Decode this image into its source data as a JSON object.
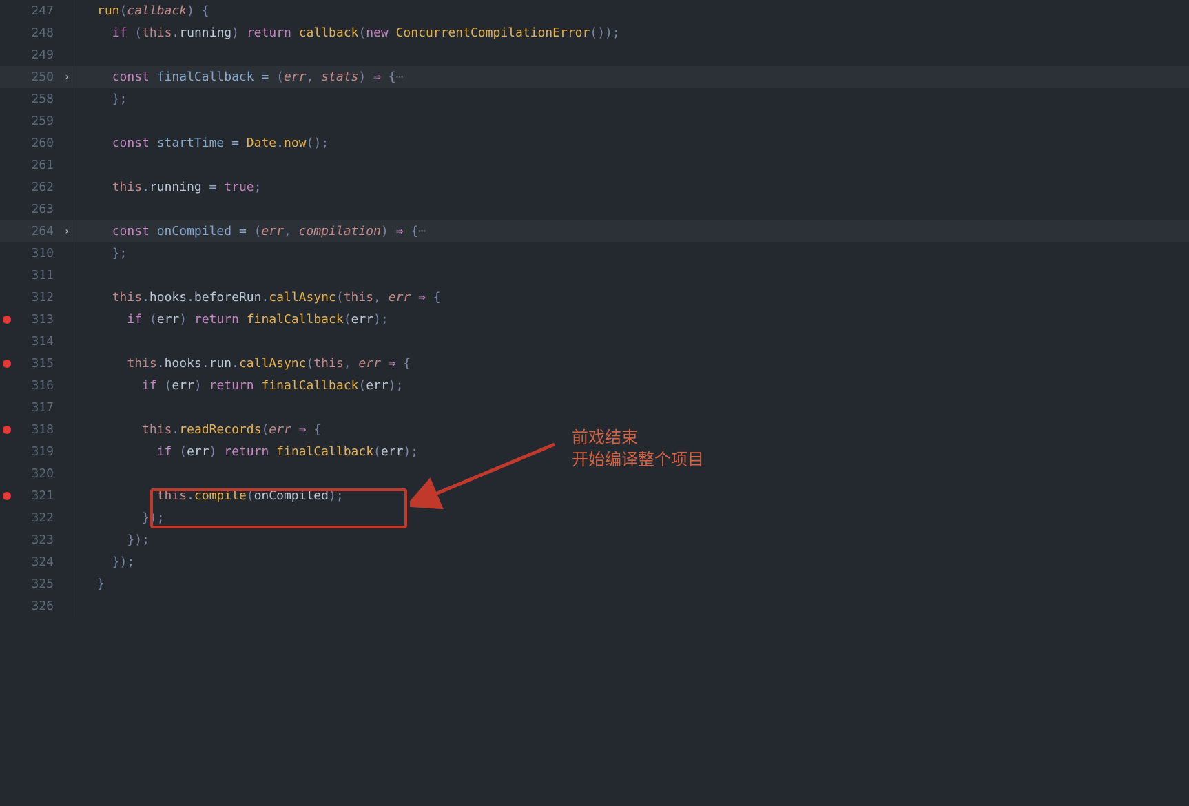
{
  "editor": {
    "font": "monospace",
    "background": "#24292f",
    "accent_breakpoint": "#e53935",
    "annotation_color": "#d36343"
  },
  "annotation": {
    "line1": "前戏结束",
    "line2": "开始编译整个项目"
  },
  "lines": [
    {
      "no": "247",
      "bp": false,
      "fold": "",
      "hl": false,
      "tokens": [
        {
          "t": "fn",
          "v": "run"
        },
        {
          "t": "br",
          "v": "("
        },
        {
          "t": "arg",
          "v": "callback"
        },
        {
          "t": "br",
          "v": ") {"
        }
      ]
    },
    {
      "no": "248",
      "bp": false,
      "fold": "",
      "hl": false,
      "tokens": [
        {
          "t": "id",
          "v": "  "
        },
        {
          "t": "kw",
          "v": "if"
        },
        {
          "t": "br",
          "v": " ("
        },
        {
          "t": "this",
          "v": "this"
        },
        {
          "t": "op",
          "v": "."
        },
        {
          "t": "id",
          "v": "running"
        },
        {
          "t": "br",
          "v": ") "
        },
        {
          "t": "kw",
          "v": "return"
        },
        {
          "t": "id",
          "v": " "
        },
        {
          "t": "fn",
          "v": "callback"
        },
        {
          "t": "br",
          "v": "("
        },
        {
          "t": "kw",
          "v": "new"
        },
        {
          "t": "id",
          "v": " "
        },
        {
          "t": "type",
          "v": "ConcurrentCompilationError"
        },
        {
          "t": "br",
          "v": "());"
        }
      ]
    },
    {
      "no": "249",
      "bp": false,
      "fold": "",
      "hl": false,
      "tokens": []
    },
    {
      "no": "250",
      "bp": false,
      "fold": "›",
      "hl": true,
      "tokens": [
        {
          "t": "id",
          "v": "  "
        },
        {
          "t": "kw",
          "v": "const"
        },
        {
          "t": "id",
          "v": " "
        },
        {
          "t": "fnid",
          "v": "finalCallback"
        },
        {
          "t": "id",
          "v": " "
        },
        {
          "t": "op",
          "v": "="
        },
        {
          "t": "id",
          "v": " "
        },
        {
          "t": "br",
          "v": "("
        },
        {
          "t": "arg",
          "v": "err"
        },
        {
          "t": "br",
          "v": ", "
        },
        {
          "t": "arg",
          "v": "stats"
        },
        {
          "t": "br",
          "v": ") "
        },
        {
          "t": "arrow",
          "v": "⇒"
        },
        {
          "t": "br",
          "v": " {"
        },
        {
          "t": "fold-ellipsis",
          "v": "⋯"
        }
      ]
    },
    {
      "no": "258",
      "bp": false,
      "fold": "",
      "hl": false,
      "tokens": [
        {
          "t": "id",
          "v": "  "
        },
        {
          "t": "br",
          "v": "};"
        }
      ]
    },
    {
      "no": "259",
      "bp": false,
      "fold": "",
      "hl": false,
      "tokens": []
    },
    {
      "no": "260",
      "bp": false,
      "fold": "",
      "hl": false,
      "tokens": [
        {
          "t": "id",
          "v": "  "
        },
        {
          "t": "kw",
          "v": "const"
        },
        {
          "t": "id",
          "v": " "
        },
        {
          "t": "fnid",
          "v": "startTime"
        },
        {
          "t": "id",
          "v": " "
        },
        {
          "t": "op",
          "v": "="
        },
        {
          "t": "id",
          "v": " "
        },
        {
          "t": "type",
          "v": "Date"
        },
        {
          "t": "op",
          "v": "."
        },
        {
          "t": "fn",
          "v": "now"
        },
        {
          "t": "br",
          "v": "();"
        }
      ]
    },
    {
      "no": "261",
      "bp": false,
      "fold": "",
      "hl": false,
      "tokens": []
    },
    {
      "no": "262",
      "bp": false,
      "fold": "",
      "hl": false,
      "tokens": [
        {
          "t": "id",
          "v": "  "
        },
        {
          "t": "this",
          "v": "this"
        },
        {
          "t": "op",
          "v": "."
        },
        {
          "t": "id",
          "v": "running"
        },
        {
          "t": "id",
          "v": " "
        },
        {
          "t": "op",
          "v": "="
        },
        {
          "t": "id",
          "v": " "
        },
        {
          "t": "kw",
          "v": "true"
        },
        {
          "t": "br",
          "v": ";"
        }
      ]
    },
    {
      "no": "263",
      "bp": false,
      "fold": "",
      "hl": false,
      "tokens": []
    },
    {
      "no": "264",
      "bp": false,
      "fold": "›",
      "hl": true,
      "tokens": [
        {
          "t": "id",
          "v": "  "
        },
        {
          "t": "kw",
          "v": "const"
        },
        {
          "t": "id",
          "v": " "
        },
        {
          "t": "fnid",
          "v": "onCompiled"
        },
        {
          "t": "id",
          "v": " "
        },
        {
          "t": "op",
          "v": "="
        },
        {
          "t": "id",
          "v": " "
        },
        {
          "t": "br",
          "v": "("
        },
        {
          "t": "arg",
          "v": "err"
        },
        {
          "t": "br",
          "v": ", "
        },
        {
          "t": "arg",
          "v": "compilation"
        },
        {
          "t": "br",
          "v": ") "
        },
        {
          "t": "arrow",
          "v": "⇒"
        },
        {
          "t": "br",
          "v": " {"
        },
        {
          "t": "fold-ellipsis",
          "v": "⋯"
        }
      ]
    },
    {
      "no": "310",
      "bp": false,
      "fold": "",
      "hl": false,
      "tokens": [
        {
          "t": "id",
          "v": "  "
        },
        {
          "t": "br",
          "v": "};"
        }
      ]
    },
    {
      "no": "311",
      "bp": false,
      "fold": "",
      "hl": false,
      "tokens": []
    },
    {
      "no": "312",
      "bp": false,
      "fold": "",
      "hl": false,
      "tokens": [
        {
          "t": "id",
          "v": "  "
        },
        {
          "t": "this",
          "v": "this"
        },
        {
          "t": "op",
          "v": "."
        },
        {
          "t": "id",
          "v": "hooks"
        },
        {
          "t": "op",
          "v": "."
        },
        {
          "t": "id",
          "v": "beforeRun"
        },
        {
          "t": "op",
          "v": "."
        },
        {
          "t": "fn",
          "v": "callAsync"
        },
        {
          "t": "br",
          "v": "("
        },
        {
          "t": "this",
          "v": "this"
        },
        {
          "t": "br",
          "v": ", "
        },
        {
          "t": "arg",
          "v": "err"
        },
        {
          "t": "id",
          "v": " "
        },
        {
          "t": "arrow",
          "v": "⇒"
        },
        {
          "t": "br",
          "v": " {"
        }
      ]
    },
    {
      "no": "313",
      "bp": true,
      "fold": "",
      "hl": false,
      "tokens": [
        {
          "t": "id",
          "v": "    "
        },
        {
          "t": "kw",
          "v": "if"
        },
        {
          "t": "br",
          "v": " ("
        },
        {
          "t": "id",
          "v": "err"
        },
        {
          "t": "br",
          "v": ") "
        },
        {
          "t": "kw",
          "v": "return"
        },
        {
          "t": "id",
          "v": " "
        },
        {
          "t": "fn",
          "v": "finalCallback"
        },
        {
          "t": "br",
          "v": "("
        },
        {
          "t": "id",
          "v": "err"
        },
        {
          "t": "br",
          "v": ");"
        }
      ]
    },
    {
      "no": "314",
      "bp": false,
      "fold": "",
      "hl": false,
      "tokens": []
    },
    {
      "no": "315",
      "bp": true,
      "fold": "",
      "hl": false,
      "tokens": [
        {
          "t": "id",
          "v": "    "
        },
        {
          "t": "this",
          "v": "this"
        },
        {
          "t": "op",
          "v": "."
        },
        {
          "t": "id",
          "v": "hooks"
        },
        {
          "t": "op",
          "v": "."
        },
        {
          "t": "id",
          "v": "run"
        },
        {
          "t": "op",
          "v": "."
        },
        {
          "t": "fn",
          "v": "callAsync"
        },
        {
          "t": "br",
          "v": "("
        },
        {
          "t": "this",
          "v": "this"
        },
        {
          "t": "br",
          "v": ", "
        },
        {
          "t": "arg",
          "v": "err"
        },
        {
          "t": "id",
          "v": " "
        },
        {
          "t": "arrow",
          "v": "⇒"
        },
        {
          "t": "br",
          "v": " {"
        }
      ]
    },
    {
      "no": "316",
      "bp": false,
      "fold": "",
      "hl": false,
      "tokens": [
        {
          "t": "id",
          "v": "      "
        },
        {
          "t": "kw",
          "v": "if"
        },
        {
          "t": "br",
          "v": " ("
        },
        {
          "t": "id",
          "v": "err"
        },
        {
          "t": "br",
          "v": ") "
        },
        {
          "t": "kw",
          "v": "return"
        },
        {
          "t": "id",
          "v": " "
        },
        {
          "t": "fn",
          "v": "finalCallback"
        },
        {
          "t": "br",
          "v": "("
        },
        {
          "t": "id",
          "v": "err"
        },
        {
          "t": "br",
          "v": ");"
        }
      ]
    },
    {
      "no": "317",
      "bp": false,
      "fold": "",
      "hl": false,
      "tokens": []
    },
    {
      "no": "318",
      "bp": true,
      "fold": "",
      "hl": false,
      "tokens": [
        {
          "t": "id",
          "v": "      "
        },
        {
          "t": "this",
          "v": "this"
        },
        {
          "t": "op",
          "v": "."
        },
        {
          "t": "fn",
          "v": "readRecords"
        },
        {
          "t": "br",
          "v": "("
        },
        {
          "t": "arg",
          "v": "err"
        },
        {
          "t": "id",
          "v": " "
        },
        {
          "t": "arrow",
          "v": "⇒"
        },
        {
          "t": "br",
          "v": " {"
        }
      ]
    },
    {
      "no": "319",
      "bp": false,
      "fold": "",
      "hl": false,
      "tokens": [
        {
          "t": "id",
          "v": "        "
        },
        {
          "t": "kw",
          "v": "if"
        },
        {
          "t": "br",
          "v": " ("
        },
        {
          "t": "id",
          "v": "err"
        },
        {
          "t": "br",
          "v": ") "
        },
        {
          "t": "kw",
          "v": "return"
        },
        {
          "t": "id",
          "v": " "
        },
        {
          "t": "fn",
          "v": "finalCallback"
        },
        {
          "t": "br",
          "v": "("
        },
        {
          "t": "id",
          "v": "err"
        },
        {
          "t": "br",
          "v": ");"
        }
      ]
    },
    {
      "no": "320",
      "bp": false,
      "fold": "",
      "hl": false,
      "tokens": []
    },
    {
      "no": "321",
      "bp": true,
      "fold": "",
      "hl": false,
      "tokens": [
        {
          "t": "id",
          "v": "        "
        },
        {
          "t": "this",
          "v": "this"
        },
        {
          "t": "op",
          "v": "."
        },
        {
          "t": "fn",
          "v": "compile"
        },
        {
          "t": "br",
          "v": "("
        },
        {
          "t": "id",
          "v": "onCompiled"
        },
        {
          "t": "br",
          "v": ");"
        }
      ]
    },
    {
      "no": "322",
      "bp": false,
      "fold": "",
      "hl": false,
      "tokens": [
        {
          "t": "id",
          "v": "      "
        },
        {
          "t": "br",
          "v": "});"
        }
      ]
    },
    {
      "no": "323",
      "bp": false,
      "fold": "",
      "hl": false,
      "tokens": [
        {
          "t": "id",
          "v": "    "
        },
        {
          "t": "br",
          "v": "});"
        }
      ]
    },
    {
      "no": "324",
      "bp": false,
      "fold": "",
      "hl": false,
      "tokens": [
        {
          "t": "id",
          "v": "  "
        },
        {
          "t": "br",
          "v": "});"
        }
      ]
    },
    {
      "no": "325",
      "bp": false,
      "fold": "",
      "hl": false,
      "tokens": [
        {
          "t": "br",
          "v": "}"
        }
      ]
    },
    {
      "no": "326",
      "bp": false,
      "fold": "",
      "hl": false,
      "tokens": []
    }
  ]
}
